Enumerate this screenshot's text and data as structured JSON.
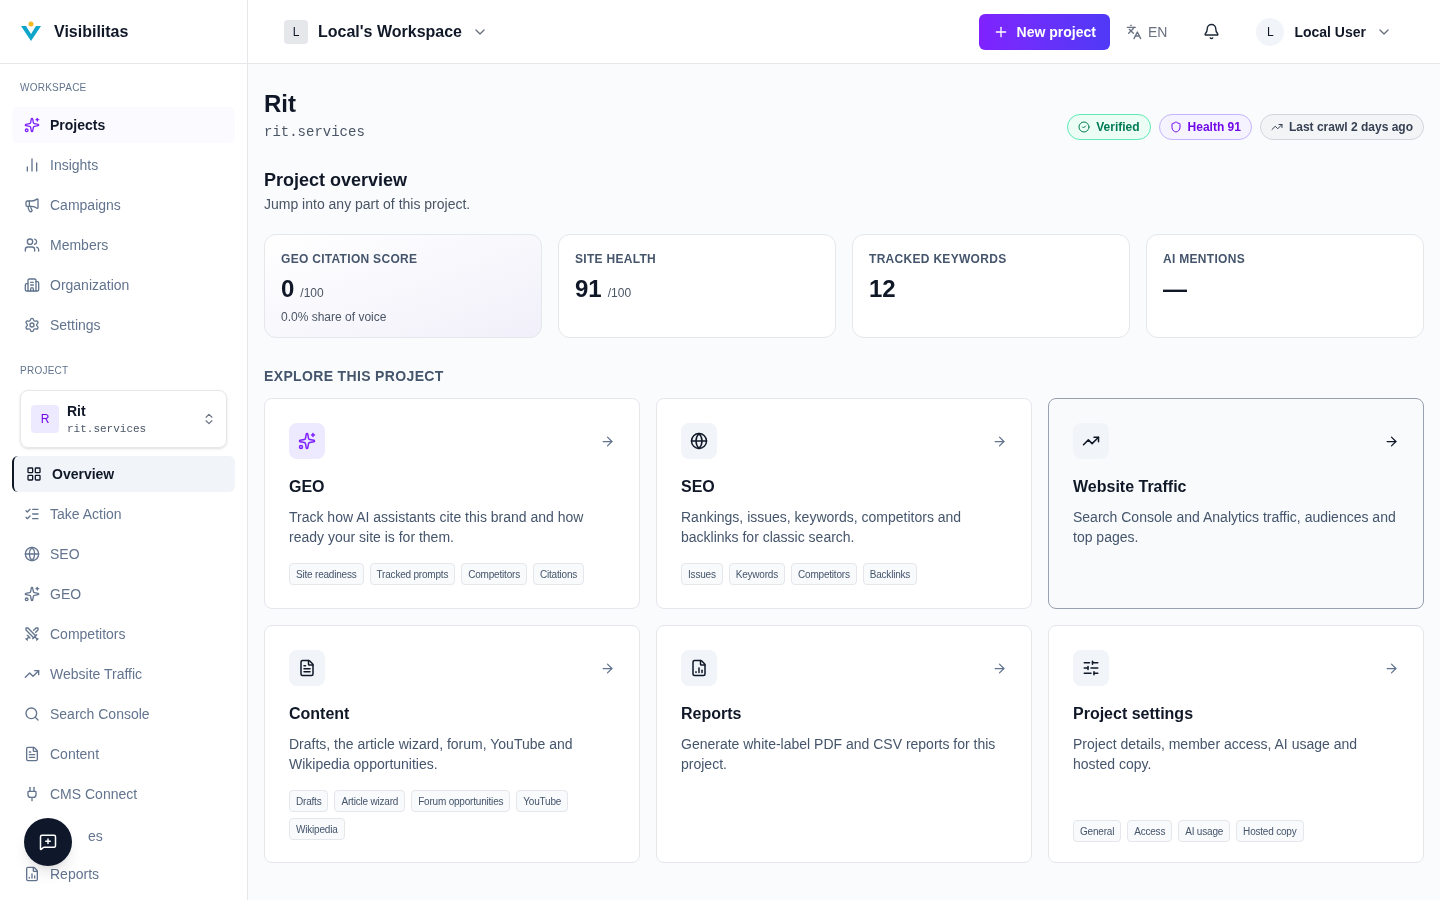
{
  "brand": {
    "name": "Visibilitas"
  },
  "topbar": {
    "workspace": {
      "initial": "L",
      "name": "Local's Workspace"
    },
    "new_project": "New project",
    "language": "EN",
    "user": {
      "initial": "L",
      "name": "Local User"
    }
  },
  "sidebar": {
    "sections": [
      {
        "title": "WORKSPACE",
        "items": [
          {
            "kind": "link",
            "label": "Projects",
            "selected": true
          },
          {
            "kind": "link",
            "label": "Insights",
            "selected": false
          },
          {
            "kind": "link",
            "label": "Campaigns",
            "selected": false
          },
          {
            "kind": "link",
            "label": "Members",
            "selected": false
          },
          {
            "kind": "link",
            "label": "Organization",
            "selected": false
          },
          {
            "kind": "link",
            "label": "Settings",
            "selected": false
          }
        ]
      },
      {
        "title": "PROJECT",
        "project": {
          "initial": "R",
          "name": "Rit",
          "domain": "rit.services"
        },
        "items": [
          {
            "kind": "link",
            "label": "Overview",
            "selected": true
          },
          {
            "kind": "link",
            "label": "Take Action",
            "selected": false
          },
          {
            "kind": "link",
            "label": "SEO",
            "selected": false
          },
          {
            "kind": "link",
            "label": "GEO",
            "selected": false
          },
          {
            "kind": "link",
            "label": "Competitors",
            "selected": false
          },
          {
            "kind": "link",
            "label": "Website Traffic",
            "selected": false
          },
          {
            "kind": "link",
            "label": "Search Console",
            "selected": false
          },
          {
            "kind": "link",
            "label": "Content",
            "selected": false
          },
          {
            "kind": "link",
            "label": "CMS Connect",
            "selected": false
          },
          {
            "kind": "partial",
            "label": "es",
            "selected": false
          },
          {
            "kind": "link",
            "label": "Reports",
            "selected": false
          }
        ]
      }
    ]
  },
  "page": {
    "title": "Rit",
    "domain": "rit.services",
    "badges": [
      {
        "kind": "success",
        "label": "Verified"
      },
      {
        "kind": "accent",
        "label": "Health 91"
      },
      {
        "kind": "neutral",
        "label": "Last crawl 2 days ago"
      }
    ],
    "heading": "Project overview",
    "subheading": "Jump into any part of this project.",
    "stats": [
      {
        "label": "GEO CITATION SCORE",
        "value": "0",
        "suffix": "/100",
        "note": "0.0% share of voice",
        "highlighted": true
      },
      {
        "label": "SITE HEALTH",
        "value": "91",
        "suffix": "/100",
        "highlighted": false
      },
      {
        "label": "TRACKED KEYWORDS",
        "value": "12",
        "highlighted": false
      },
      {
        "label": "AI MENTIONS",
        "value": "—",
        "highlighted": false
      }
    ],
    "explore_title": "EXPLORE THIS PROJECT",
    "cards": [
      {
        "title": "GEO",
        "description": "Track how AI assistants cite this brand and how ready your site is for them.",
        "tags": [
          "Site readiness",
          "Tracked prompts",
          "Competitors",
          "Citations"
        ],
        "selected": false,
        "accent": true
      },
      {
        "title": "SEO",
        "description": "Rankings, issues, keywords, competitors and backlinks for classic search.",
        "tags": [
          "Issues",
          "Keywords",
          "Competitors",
          "Backlinks"
        ],
        "selected": false,
        "accent": false
      },
      {
        "title": "Website Traffic",
        "description": "Search Console and Analytics traffic, audiences and top pages.",
        "selected": true,
        "accent": false
      },
      {
        "title": "Content",
        "description": "Drafts, the article wizard, forum, YouTube and Wikipedia opportunities.",
        "tags": [
          "Drafts",
          "Article wizard",
          "Forum opportunities",
          "YouTube",
          "Wikipedia"
        ],
        "selected": false,
        "accent": false
      },
      {
        "title": "Reports",
        "description": "Generate white-label PDF and CSV reports for this project.",
        "selected": false,
        "accent": false
      },
      {
        "title": "Project settings",
        "description": "Project details, member access, AI usage and hosted copy.",
        "tags": [
          "General",
          "Access",
          "AI usage",
          "Hosted copy"
        ],
        "selected": false,
        "accent": false
      }
    ]
  }
}
